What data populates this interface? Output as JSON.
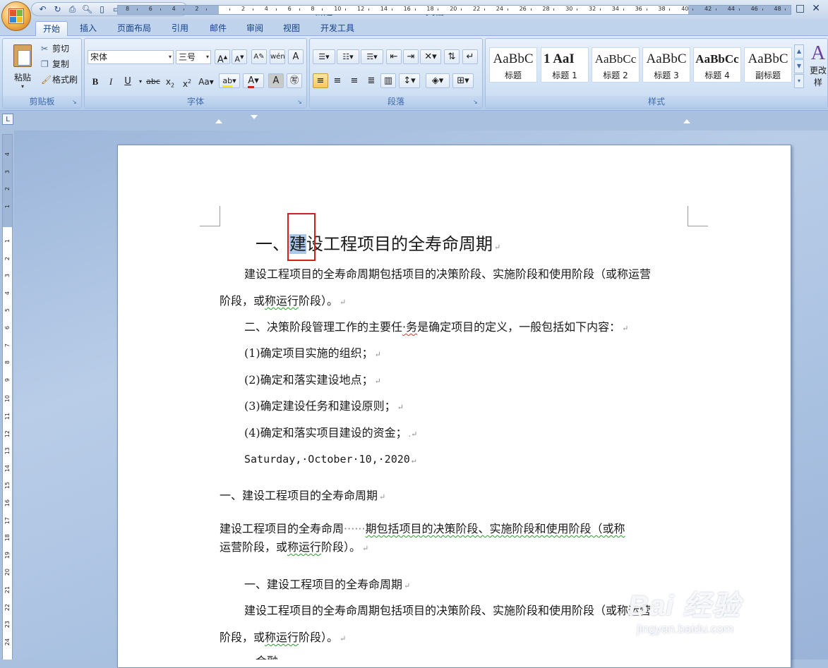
{
  "window": {
    "title": "新建 Microsoft Office Word 文档 - Microsoft Word",
    "controls": [
      "–",
      "□",
      "✕"
    ]
  },
  "quick_access": {
    "icons": [
      "undo-icon",
      "redo-icon",
      "print-icon",
      "print-preview-icon",
      "page-icon",
      "new-doc-icon",
      "circle-icon",
      "spell-icon",
      "save-icon"
    ]
  },
  "ribbon_tabs": [
    "开始",
    "插入",
    "页面布局",
    "引用",
    "邮件",
    "审阅",
    "视图",
    "开发工具"
  ],
  "clipboard": {
    "paste_label": "粘贴",
    "cut_label": "剪切",
    "copy_label": "复制",
    "format_painter_label": "格式刷",
    "group_label": "剪贴板"
  },
  "font": {
    "font_name": "宋体",
    "font_size": "三号",
    "group_label": "字体"
  },
  "paragraph": {
    "group_label": "段落"
  },
  "styles": {
    "items": [
      {
        "sample": "AaBbC",
        "name": "标题"
      },
      {
        "sample": "1  AaI",
        "name": "标题 1"
      },
      {
        "sample": "AaBbCc",
        "name": "标题 2"
      },
      {
        "sample": "AaBbC",
        "name": "标题 3"
      },
      {
        "sample": "AaBbCc",
        "name": "标题 4"
      },
      {
        "sample": "AaBbC",
        "name": "副标题"
      }
    ],
    "change_styles_label": "更改样",
    "group_label": "样式"
  },
  "ruler": {
    "h_labels": [
      "8",
      "6",
      "4",
      "2",
      "",
      "2",
      "4",
      "6",
      "8",
      "10",
      "12",
      "14",
      "16",
      "18",
      "20",
      "22",
      "24",
      "26",
      "28",
      "30",
      "32",
      "34",
      "36",
      "38",
      "40",
      "42",
      "44",
      "46",
      "48"
    ],
    "v_labels": [
      "4",
      "3",
      "2",
      "1",
      "",
      "1",
      "2",
      "3",
      "4",
      "5",
      "6",
      "7",
      "8",
      "9",
      "10",
      "11",
      "12",
      "13",
      "14",
      "15",
      "16",
      "17",
      "18",
      "19",
      "20",
      "21",
      "22",
      "23",
      "24"
    ]
  },
  "document": {
    "heading_prefix": "一、",
    "heading_selected": "建",
    "heading_rest": "设工程项目的全寿命周期",
    "p1_line1": "建设工程项目的全寿命周期包括项目的决策阶段、实施阶段和使用阶段（或称运营",
    "p1_line2_a": "阶段，或",
    "p1_line2_b": "称运行",
    "p1_line2_c": "阶段）。",
    "p2_a": "二、决策阶段管理工作的主要任",
    "p2_b": "·务",
    "p2_c": "是确定项目的定义，一般包括如下内容：",
    "item1": "(1)确定项目实施的组织；",
    "item2": "(2)确定和落实建设地点；",
    "item3": "(3)确定建设任务和建设原则；",
    "item4": "(4)确定和落实项目建设的资金；",
    "date_line": "Saturday,·October·10,·2020",
    "p3": "一、建设工程项目的全寿命周期",
    "p4_line1_a": "建设工程项目的全寿命周",
    "p4_line1_b": "······",
    "p4_line1_c": "期包括项目的决策阶段、实施阶段和使用阶段（或称",
    "p4_line2_a": "运营阶段，或",
    "p4_line2_b": "称运行",
    "p4_line2_c": "阶段）。",
    "p5": "一、建设工程项目的全寿命周期",
    "p6_line1": "建设工程项目的全寿命周期包括项目的决策阶段、实施阶段和使用阶段（或称运营",
    "p6_line2_a": "阶段，或",
    "p6_line2_b": "称运行",
    "p6_line2_c": "阶段）。",
    "p7_partial": "、金融"
  },
  "watermark": {
    "main": "Bai 经验",
    "sub": "jingyan.baidu.com"
  },
  "colors": {
    "ribbon_text": "#15428b",
    "selection": "#aac7ea",
    "highlight_box": "#d01f1f"
  }
}
